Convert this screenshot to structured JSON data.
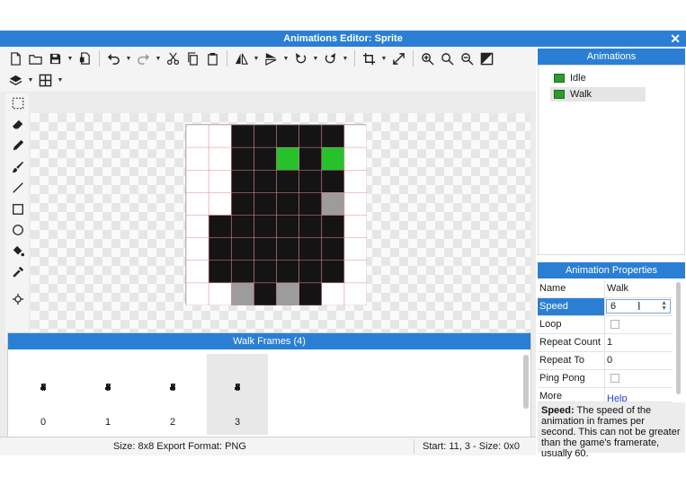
{
  "window": {
    "title": "Animations Editor: Sprite"
  },
  "toolbar": {
    "row1": [
      "new-file-icon",
      "open-folder-icon",
      "save-icon",
      "save-menu-caret",
      "export-icon",
      "undo-icon",
      "undo-menu-caret",
      "redo-icon",
      "redo-menu-caret",
      "cut-icon",
      "copy-icon",
      "paste-icon",
      "flip-horizontal-icon",
      "flip-menu-caret",
      "flip-vertical-icon",
      "flip-v-menu-caret",
      "rotate-left-icon",
      "rotate-left-caret",
      "rotate-right-icon",
      "rotate-right-caret",
      "crop-icon",
      "crop-caret",
      "resize-icon",
      "zoom-in-icon",
      "zoom-reset-icon",
      "zoom-out-icon",
      "invert-icon"
    ],
    "row2": [
      "layers-icon",
      "layers-caret",
      "grid-icon",
      "grid-caret"
    ]
  },
  "tools": [
    "select-icon",
    "eraser-icon",
    "pencil-icon",
    "brush-icon",
    "line-icon",
    "rectangle-icon",
    "ellipse-icon",
    "fill-icon",
    "color-picker-icon",
    "origin-icon"
  ],
  "sprite": {
    "size": 8,
    "pixels": [
      "..BBBBB.",
      "..BBGBG.",
      "..BBBBB.",
      "..BBBBg.",
      ".BBBBBB.",
      ".BBBBBB.",
      ".BBBBBB.",
      "..gBgB.."
    ],
    "colors": {
      "B": "#141414",
      "G": "#27c22b",
      "g": "#9c9c9c",
      ".": "#ffffff"
    }
  },
  "frames_panel": {
    "title": "Walk Frames (4)",
    "frames": [
      {
        "number": "0",
        "selected": false
      },
      {
        "number": "1",
        "selected": false
      },
      {
        "number": "2",
        "selected": false
      },
      {
        "number": "3",
        "selected": true
      }
    ]
  },
  "statusbar": {
    "left": "Size: 8x8   Export Format: PNG",
    "right": "Start: 11, 3 - Size: 0x0"
  },
  "animations_panel": {
    "title": "Animations",
    "items": [
      {
        "label": "Idle",
        "selected": false
      },
      {
        "label": "Walk",
        "selected": true
      }
    ]
  },
  "properties_panel": {
    "title": "Animation Properties",
    "rows": [
      {
        "key": "Name",
        "value": "Walk",
        "type": "text"
      },
      {
        "key": "Speed",
        "value": "6",
        "type": "input",
        "selected": true
      },
      {
        "key": "Loop",
        "value": "",
        "type": "checkbox"
      },
      {
        "key": "Repeat Count",
        "value": "1",
        "type": "text"
      },
      {
        "key": "Repeat To",
        "value": "0",
        "type": "text"
      },
      {
        "key": "Ping Pong",
        "value": "",
        "type": "checkbox"
      },
      {
        "key": "More",
        "value": "Help",
        "type": "link"
      }
    ],
    "description_key": "Speed:",
    "description_text": " The speed of the animation in frames per second. This can not be greater than the game's framerate, usually 60."
  },
  "colors": {
    "accent": "#2a7fd4",
    "sprite_green": "#27c22b"
  }
}
